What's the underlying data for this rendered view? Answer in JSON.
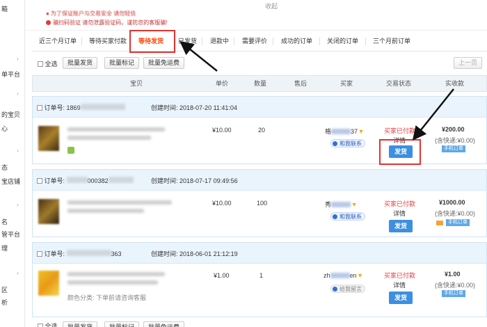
{
  "sidebar": {
    "items": [
      "箱",
      "单平台",
      "的宝贝",
      "心",
      "态",
      "宝店铺",
      "名",
      "管平台",
      "理",
      "区",
      "析"
    ]
  },
  "topbar": {
    "collapse_label": "收起",
    "notice_line1": "● 为了保证账户与交易安全 请勿轻信",
    "notice_line2": "骗扫码验证 请勿泄露验证码，谨防您的客服骗!"
  },
  "tabs": [
    "近三个月订单",
    "等待买家付款",
    "等待发货",
    "已发货",
    "退款中",
    "需要评价",
    "成功的订单",
    "关闭的订单",
    "三个月前订单"
  ],
  "active_tab": "等待发货",
  "toolbar": {
    "select_all": "全选",
    "bulk_ship": "批量发货",
    "bulk_mark": "批量标记",
    "bulk_free": "批量免运费",
    "prev_page": "上一页"
  },
  "columns": {
    "item": "宝贝",
    "price": "单价",
    "qty": "数量",
    "after_sale": "售后",
    "buyer": "买家",
    "status": "交易状态",
    "amount": "实收款"
  },
  "orders": [
    {
      "order_label": "订单号:",
      "order_no_prefix": "1869",
      "created_label": "创建时间:",
      "created_time": "2018-07-20 11:41:04",
      "price": "¥10.00",
      "qty": "20",
      "buyer_prefix": "格",
      "buyer_suffix": "37",
      "contact": "和我联系",
      "status": "买家已付款",
      "detail": "详情",
      "ship": "发货",
      "amount": "¥200.00",
      "shipping": "(含快递:¥0.00)",
      "tag": "手机订单"
    },
    {
      "order_label": "订单号:",
      "order_no_prefix": "",
      "order_no_mid": "000382",
      "created_label": "创建时间:",
      "created_time": "2018-07-17 09:49:56",
      "price": "¥10.00",
      "qty": "100",
      "buyer_prefix": "秀",
      "buyer_suffix": "",
      "contact": "和我联系",
      "status": "买家已付款",
      "detail": "详情",
      "ship": "发货",
      "amount": "¥1000.00",
      "shipping": "(含快递:¥0.00)",
      "tag": "手机订单"
    },
    {
      "order_label": "订单号:",
      "order_no_suffix": "363",
      "created_label": "创建时间:",
      "created_time": "2018-06-01 21:12:19",
      "price": "¥1.00",
      "qty": "1",
      "buyer_prefix": "zh",
      "buyer_suffix": "en",
      "contact": "给我留言",
      "color_label": "颜色分类: 下单前请咨询客服",
      "status": "买家已付款",
      "detail": "详情",
      "ship": "发货",
      "amount": "¥1.00",
      "shipping": "(含快递:¥0.00)",
      "tag": "手机订单"
    }
  ],
  "bottom_toolbar": {
    "select_all": "全选",
    "bulk_ship": "批量发货",
    "bulk_mark": "批量标记",
    "bulk_free": "批量免运费"
  },
  "colors": {
    "accent_red": "#e0322f",
    "ship_blue": "#3d8fe0",
    "header_blue": "#eaf4fc"
  }
}
